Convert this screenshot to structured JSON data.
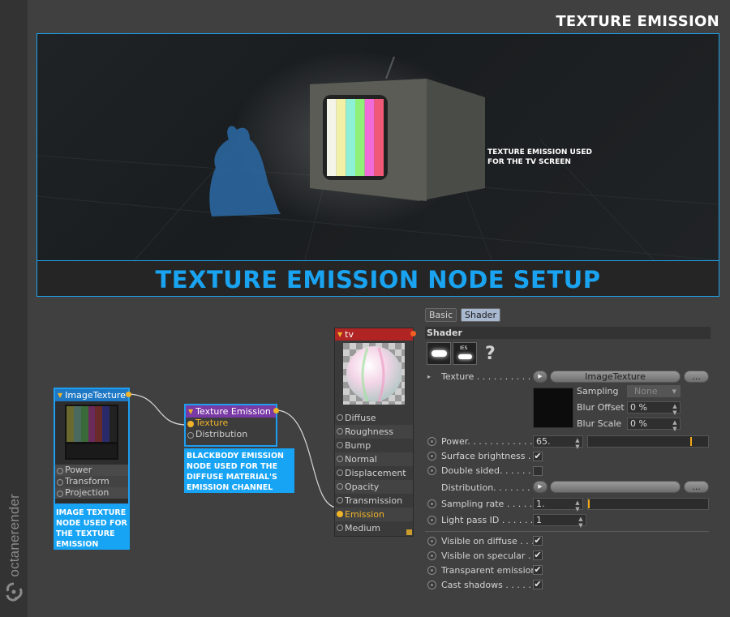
{
  "page": {
    "title": "TEXTURE EMISSION",
    "brand": "octanerender",
    "brand_tm": "™"
  },
  "render": {
    "caption": "TEXTURE EMISSION USED\nFOR THE  TV SCREEN",
    "bar_colors": [
      "#f4f4e8",
      "#f2f0a4",
      "#8ff0d8",
      "#8ff078",
      "#f06ad8",
      "#f05a78"
    ]
  },
  "node_setup_title": "TEXTURE EMISSION NODE SETUP",
  "nodes": {
    "image_texture": {
      "title": "ImageTexture",
      "pins": [
        "Power",
        "Transform",
        "Projection"
      ],
      "callout": "IMAGE TEXTURE\nNODE USED FOR\nTHE TEXTURE\nEMISSION"
    },
    "texture_emission": {
      "title": "Texture Emission",
      "pins": [
        "Texture",
        "Distribution"
      ],
      "callout": "BLACKBODY EMISSION\nNODE USED FOR THE\nDIFFUSE MATERIAL'S\nEMISSION CHANNEL"
    },
    "tv": {
      "title": "tv",
      "pins": [
        "Diffuse",
        "Roughness",
        "Bump",
        "Normal",
        "Displacement",
        "Opacity",
        "Transmission",
        "Emission",
        "Medium"
      ],
      "active_pin": "Emission"
    }
  },
  "attributes": {
    "tabs": [
      "Basic",
      "Shader"
    ],
    "active_tab": "Shader",
    "section": "Shader",
    "icon_ies": "IES",
    "help": "?",
    "texture": {
      "label": "Texture . . . . . . . . . . . .",
      "value": "ImageTexture",
      "more": "..."
    },
    "sampling": {
      "label": "Sampling",
      "value": "None"
    },
    "blur_offset": {
      "label": "Blur Offset",
      "value": "0 %"
    },
    "blur_scale": {
      "label": "Blur Scale",
      "value": "0 %"
    },
    "power": {
      "label": "Power. . . . . . . . . . . . . .",
      "value": "65.",
      "fraction": 0.86
    },
    "surface_brightness": {
      "label": "Surface brightness . .",
      "checked": true
    },
    "double_sided": {
      "label": "Double sided. . . . . . .",
      "checked": false
    },
    "distribution": {
      "label": "Distribution. . . . . . . .",
      "more": "..."
    },
    "sampling_rate": {
      "label": "Sampling rate . . . . . .",
      "value": "1.",
      "fraction": 0.0
    },
    "light_pass_id": {
      "label": "Light pass ID . . . . . .",
      "value": "1"
    },
    "visible_on_diffuse": {
      "label": "Visible on diffuse . . .",
      "checked": true
    },
    "visible_on_specular": {
      "label": "Visible on specular . .",
      "checked": true
    },
    "transparent_emission": {
      "label": "Transparent emission",
      "checked": true
    },
    "cast_shadows": {
      "label": "Cast shadows . . . . . .",
      "checked": true
    },
    "check_glyph": "✔",
    "spin_glyph": "▲▼",
    "menu_glyph": "▾"
  }
}
